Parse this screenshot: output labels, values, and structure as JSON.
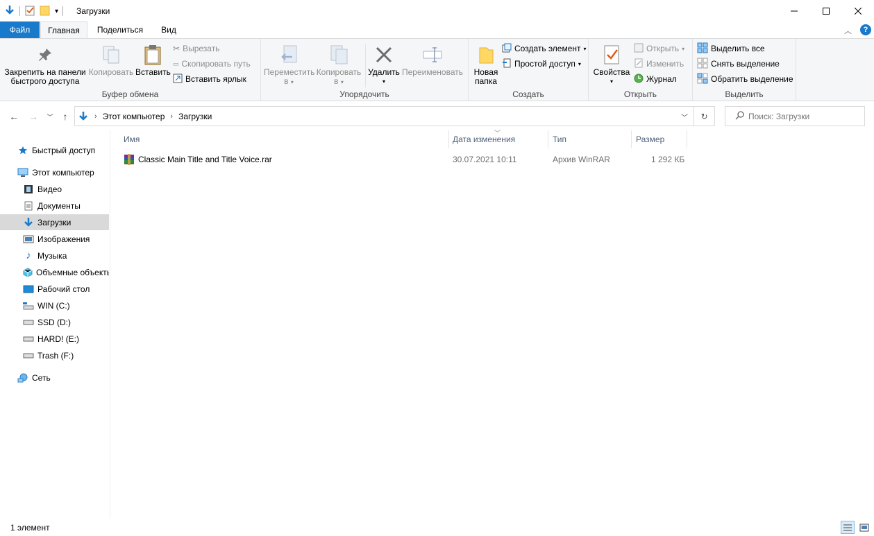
{
  "window": {
    "title": "Загрузки"
  },
  "tabs": [
    {
      "label": "Файл"
    },
    {
      "label": "Главная"
    },
    {
      "label": "Поделиться"
    },
    {
      "label": "Вид"
    }
  ],
  "ribbon": {
    "clipboard": {
      "group_label": "Буфер обмена",
      "pin_line1": "Закрепить на панели",
      "pin_line2": "быстрого доступа",
      "copy": "Копировать",
      "paste": "Вставить",
      "cut": "Вырезать",
      "copy_path": "Скопировать путь",
      "paste_shortcut": "Вставить ярлык"
    },
    "organize": {
      "group_label": "Упорядочить",
      "move_line1": "Переместить",
      "move_line2": "в",
      "copy_line1": "Копировать",
      "copy_line2": "в",
      "delete": "Удалить",
      "rename": "Переименовать"
    },
    "create": {
      "group_label": "Создать",
      "new_folder_line1": "Новая",
      "new_folder_line2": "папка",
      "new_item": "Создать элемент",
      "easy_access": "Простой доступ"
    },
    "open": {
      "group_label": "Открыть",
      "properties": "Свойства",
      "open": "Открыть",
      "edit": "Изменить",
      "history": "Журнал"
    },
    "select": {
      "group_label": "Выделить",
      "select_all": "Выделить все",
      "select_none": "Снять выделение",
      "invert": "Обратить выделение"
    }
  },
  "address": {
    "crumbs": [
      "Этот компьютер",
      "Загрузки"
    ],
    "search_placeholder": "Поиск: Загрузки"
  },
  "sidebar": {
    "items": [
      {
        "label": "Быстрый доступ",
        "icon": "star-icon"
      },
      {
        "label": "Этот компьютер",
        "icon": "computer-icon"
      },
      {
        "label": "Видео",
        "icon": "video-icon"
      },
      {
        "label": "Документы",
        "icon": "documents-icon"
      },
      {
        "label": "Загрузки",
        "icon": "downloads-icon",
        "selected": true
      },
      {
        "label": "Изображения",
        "icon": "pictures-icon"
      },
      {
        "label": "Музыка",
        "icon": "music-icon"
      },
      {
        "label": "Объемные объекты",
        "icon": "3d-objects-icon"
      },
      {
        "label": "Рабочий стол",
        "icon": "desktop-icon"
      },
      {
        "label": "WIN (C:)",
        "icon": "drive-system-icon"
      },
      {
        "label": "SSD (D:)",
        "icon": "drive-icon"
      },
      {
        "label": "HARD! (E:)",
        "icon": "drive-icon"
      },
      {
        "label": "Trash (F:)",
        "icon": "drive-icon"
      },
      {
        "label": "Сеть",
        "icon": "network-icon"
      }
    ]
  },
  "filelist": {
    "columns": [
      "Имя",
      "Дата изменения",
      "Тип",
      "Размер"
    ],
    "rows": [
      {
        "name": "Classic Main Title and Title Voice.rar",
        "date": "30.07.2021 10:11",
        "type": "Архив WinRAR",
        "size": "1 292 КБ",
        "icon": "winrar-archive-icon"
      }
    ]
  },
  "status": {
    "count": "1 элемент"
  },
  "colors": {
    "accent": "#1979ca",
    "selected_bg": "#d9d9d9",
    "ribbon_bg": "#f5f6f7"
  }
}
